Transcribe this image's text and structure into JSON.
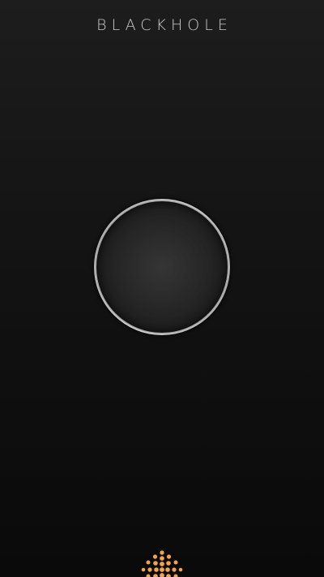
{
  "app": {
    "title": "BLACKHOLE"
  },
  "icons": {
    "sun": "sun-dots-icon"
  },
  "colors": {
    "background_top": "#1d1d1d",
    "background_bottom": "#0a0a0a",
    "title_text": "#c9c9c9",
    "ring": "#a8a8a8",
    "accent_orange": "#f2a44a"
  }
}
